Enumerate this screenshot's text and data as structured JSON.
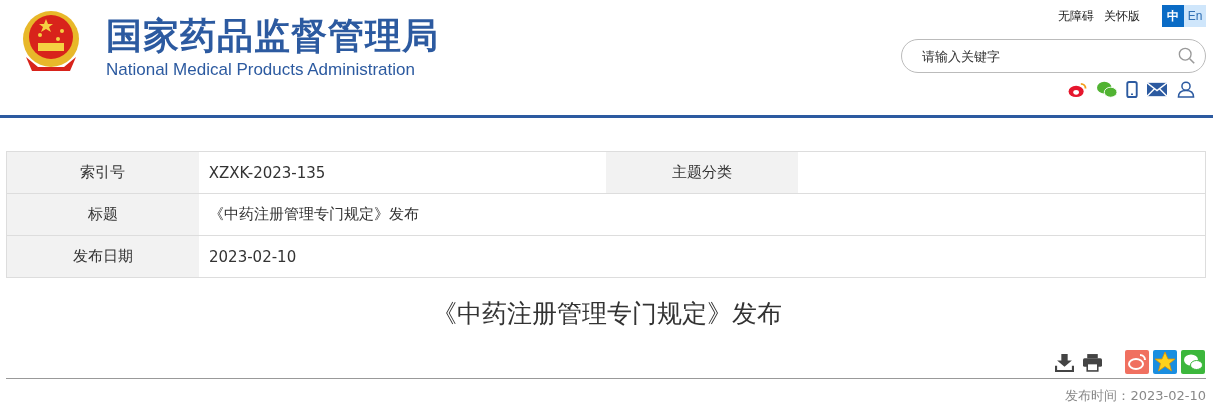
{
  "header": {
    "title_cn": "国家药品监督管理局",
    "title_en": "National Medical Products Administration",
    "links": [
      "无障碍",
      "关怀版"
    ],
    "languages": [
      {
        "label": "中",
        "selected": true
      },
      {
        "label": "En",
        "selected": false
      }
    ],
    "search": {
      "placeholder": "请输入关键字"
    }
  },
  "info_table": {
    "rows": [
      {
        "cells": [
          {
            "kind": "label",
            "text": "索引号"
          },
          {
            "kind": "value",
            "text": "XZXK-2023-135"
          },
          {
            "kind": "label",
            "text": "主题分类"
          },
          {
            "kind": "value",
            "text": ""
          }
        ]
      },
      {
        "cells": [
          {
            "kind": "label",
            "text": "标题"
          },
          {
            "kind": "wide",
            "text": "《中药注册管理专门规定》发布"
          }
        ]
      },
      {
        "cells": [
          {
            "kind": "label",
            "text": "发布日期"
          },
          {
            "kind": "wide",
            "text": "2023-02-10"
          }
        ]
      }
    ]
  },
  "article": {
    "title": "《中药注册管理专门规定》发布",
    "published": "发布时间：2023-02-10"
  }
}
